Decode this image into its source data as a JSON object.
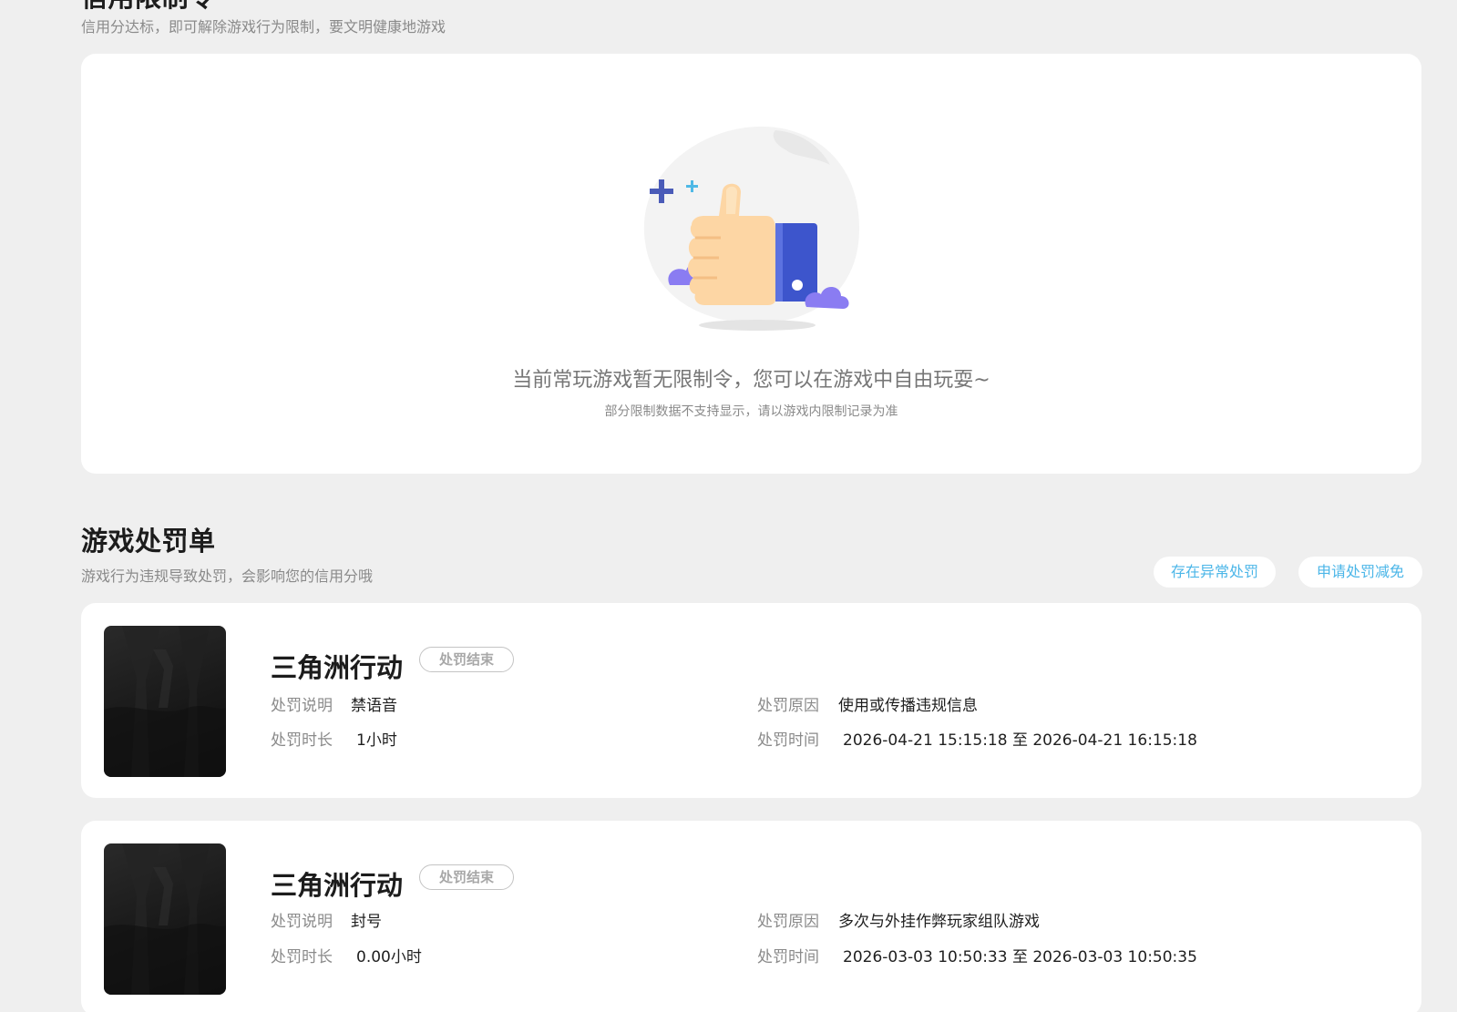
{
  "credit_section": {
    "title": "信用限制令",
    "subtitle": "信用分达标，即可解除游戏行为限制，要文明健康地游戏",
    "empty_state": {
      "main_text": "当前常玩游戏暂无限制令，您可以在游戏中自由玩耍~",
      "sub_text": "部分限制数据不支持显示，请以游戏内限制记录为准"
    }
  },
  "penalty_section": {
    "title": "游戏处罚单",
    "subtitle": "游戏行为违规导致处罚，会影响您的信用分哦",
    "buttons": {
      "abnormal": "存在异常处罚",
      "reduction": "申请处罚减免"
    },
    "labels": {
      "desc": "处罚说明",
      "duration": "处罚时长",
      "reason": "处罚原因",
      "time": "处罚时间"
    },
    "items": [
      {
        "game": "三角洲行动",
        "status": "处罚结束",
        "desc": "禁语音",
        "duration": "1小时",
        "reason": "使用或传播违规信息",
        "time": "2026-04-21 15:15:18 至 2026-04-21 16:15:18"
      },
      {
        "game": "三角洲行动",
        "status": "处罚结束",
        "desc": "封号",
        "duration": "0.00小时",
        "reason": "多次与外挂作弊玩家组队游戏",
        "time": "2026-03-03 10:50:33 至 2026-03-03 10:50:35"
      }
    ]
  },
  "colors": {
    "page_bg": "#efefef",
    "accent": "#4bb6e8",
    "thumb_blue": "#3d55cc"
  }
}
